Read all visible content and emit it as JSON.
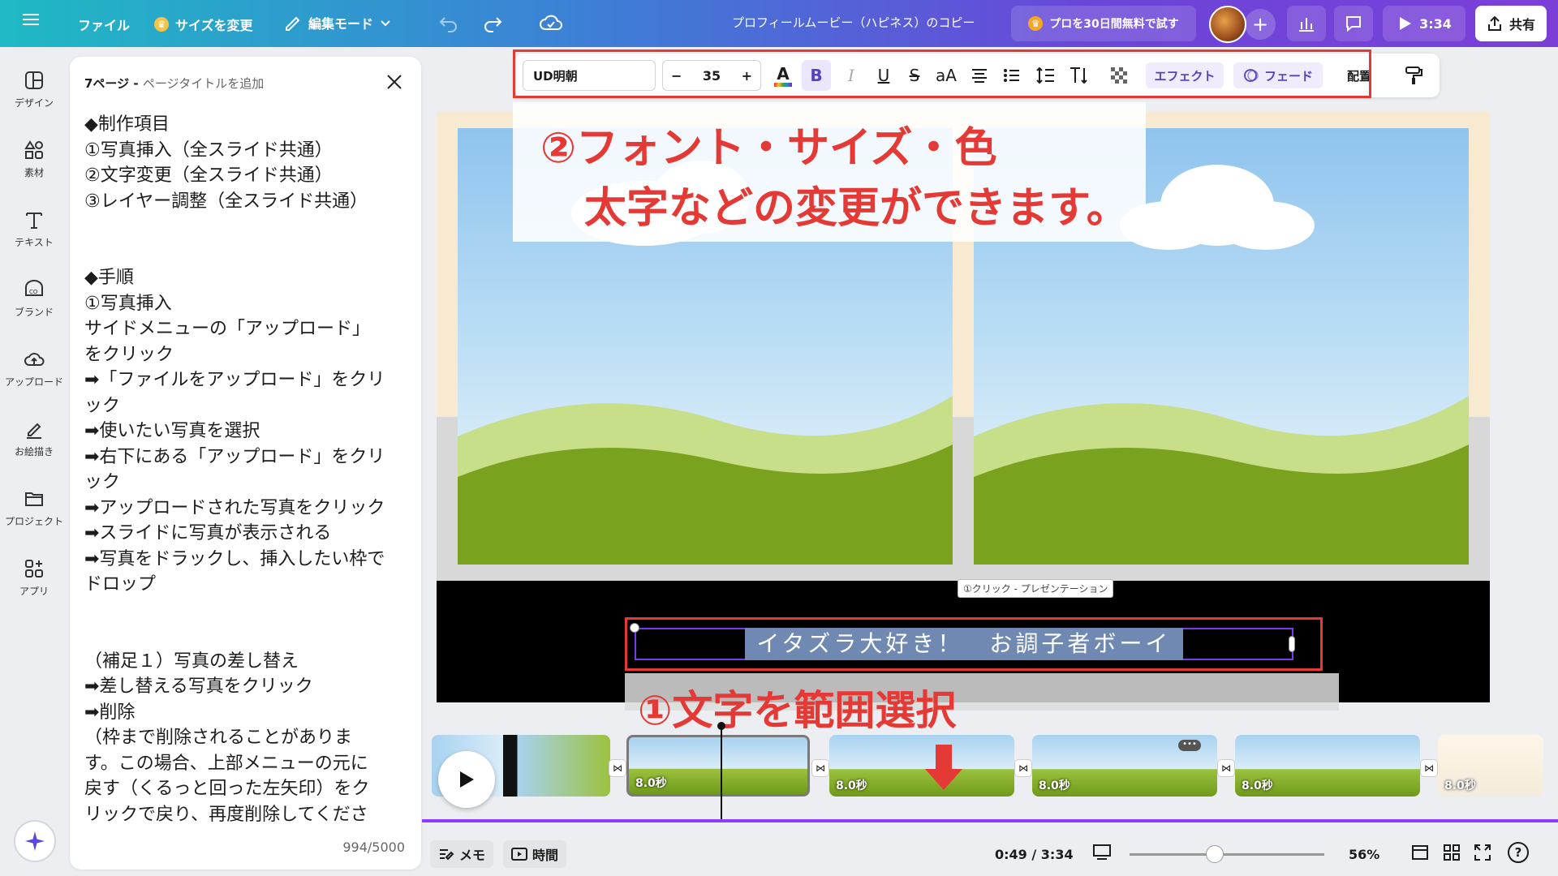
{
  "topbar": {
    "menu_icon": "hamburger-icon",
    "file_label": "ファイル",
    "resize_label": "サイズを変更",
    "edit_mode_label": "編集モード",
    "doc_title": "プロフィールムービー（ハピネス）のコピー",
    "trial_label": "プロを30日間無料で試す",
    "play_time": "3:34",
    "share_label": "共有"
  },
  "rail": {
    "items": [
      {
        "label": "デザイン",
        "icon": "design-icon"
      },
      {
        "label": "素材",
        "icon": "elements-icon"
      },
      {
        "label": "テキスト",
        "icon": "text-icon"
      },
      {
        "label": "ブランド",
        "icon": "brand-icon"
      },
      {
        "label": "アップロード",
        "icon": "upload-icon"
      },
      {
        "label": "お絵描き",
        "icon": "draw-icon"
      },
      {
        "label": "プロジェクト",
        "icon": "folder-icon"
      },
      {
        "label": "アプリ",
        "icon": "apps-icon"
      }
    ]
  },
  "notes": {
    "page_label": "7ページ - ",
    "page_title_placeholder": "ページタイトルを追加",
    "body": "◆制作項目\n①写真挿入（全スライド共通）\n②文字変更（全スライド共通）\n③レイヤー調整（全スライド共通）\n\n\n◆手順\n①写真挿入\nサイドメニューの「アップロード」\nをクリック\n➡「ファイルをアップロード」をクリ\nック\n➡使いたい写真を選択\n➡右下にある「アップロード」をクリ\nック\n➡アップロードされた写真をクリック\n➡スライドに写真が表示される\n➡写真をドラックし、挿入したい枠で\nドロップ\n\n\n（補足１）写真の差し替え\n➡差し替える写真をクリック\n➡削除\n（枠まで削除されることがありま\nす。この場合、上部メニューの元に\n戻す（くるっと回った左矢印）をク\nリックで戻り、再度削除してくださ",
    "char_count": "994/5000"
  },
  "toolbar": {
    "font_name": "UD明朝",
    "font_size": "35",
    "minus": "−",
    "plus": "+",
    "bold": "B",
    "italic": "I",
    "underline": "U",
    "strike": "S",
    "case": "aA",
    "effect_label": "エフェクト",
    "fade_label": "フェード",
    "arrange_label": "配置"
  },
  "slide": {
    "caption_tag": "①クリック - プレゼンテーション",
    "subtitle_text": "イタズラ大好き！　お調子者ボーイ"
  },
  "annotations": {
    "step2_line1": "②フォント・サイズ・色",
    "step2_line2": "太字などの変更ができます。",
    "step1": "①文字を範囲選択"
  },
  "timeline": {
    "clips": [
      {
        "duration": "8.0秒"
      },
      {
        "duration": "8.0秒"
      },
      {
        "duration": "8.0秒"
      },
      {
        "duration": "8.0秒"
      },
      {
        "duration": "8.0秒"
      },
      {
        "duration": "8.0秒"
      }
    ]
  },
  "bottombar": {
    "memo_label": "メモ",
    "time_label": "時間",
    "timecode": "0:49 / 3:34",
    "zoom": "56%",
    "help": "?"
  },
  "colors": {
    "accent_purple": "#7c3aed",
    "annotation_red": "#e53935",
    "sky": "#b8dcf5",
    "grass": "#7aa21e"
  }
}
